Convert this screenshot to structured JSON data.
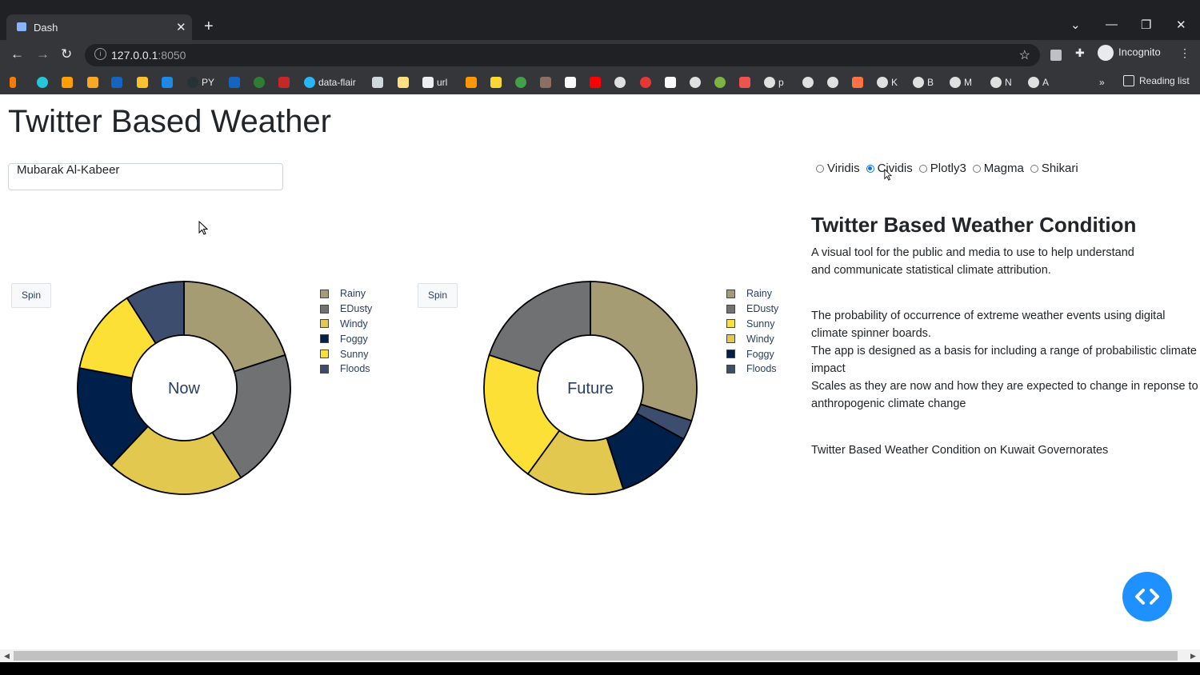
{
  "browser": {
    "tab_title": "Dash",
    "url_host": "127.0.0.1",
    "url_port": ":8050",
    "profile": "Incognito",
    "bookmarks": [
      "PY",
      "data-flair",
      "url",
      "p",
      "K",
      "B",
      "M",
      "N",
      "A"
    ],
    "reading_list": "Reading list"
  },
  "page": {
    "title": "Twitter Based Weather",
    "governorate_input": "Mubarak Al-Kabeer",
    "colorscales": [
      {
        "label": "Viridis",
        "selected": false
      },
      {
        "label": "Cividis",
        "selected": true
      },
      {
        "label": "Plotly3",
        "selected": false
      },
      {
        "label": "Magma",
        "selected": false
      },
      {
        "label": "Shikari",
        "selected": false
      }
    ],
    "spin_label": "Spin",
    "panel": {
      "heading": "Twitter Based Weather Condition",
      "intro_line1": "A visual tool for the public and media to use to help understand",
      "intro_line2": "and communicate statistical climate attribution.",
      "p1_line1": "The probability of occurrence of extreme weather events using digital",
      "p1_line2": "climate spinner boards.",
      "p2_line1": "The app is designed as a basis for including a range of probabilistic climate",
      "p2_line2": "impact",
      "p3_line1": "Scales as they are now and how they are expected to change in reponse to",
      "p3_line2": "anthropogenic climate change",
      "footer": "Twitter Based Weather Condition on Kuwait Governorates"
    }
  },
  "chart_data": [
    {
      "type": "pie",
      "hole_label": "Now",
      "categories": [
        "Rainy",
        "EDusty",
        "Windy",
        "Foggy",
        "Sunny",
        "Floods"
      ],
      "values": [
        0.2,
        0.21,
        0.21,
        0.16,
        0.13,
        0.09
      ],
      "legend_order": [
        "Rainy",
        "EDusty",
        "Windy",
        "Foggy",
        "Sunny",
        "Floods"
      ],
      "legend_placement": "right"
    },
    {
      "type": "pie",
      "hole_label": "Future",
      "categories": [
        "Rainy",
        "Floods",
        "Foggy",
        "Windy",
        "Sunny",
        "EDusty"
      ],
      "values": [
        0.3,
        0.03,
        0.12,
        0.15,
        0.2,
        0.2
      ],
      "legend_order": [
        "Rainy",
        "EDusty",
        "Sunny",
        "Windy",
        "Foggy",
        "Floods"
      ],
      "legend_placement": "right"
    }
  ],
  "colors": {
    "Rainy": "#a59c74",
    "EDusty": "#707173",
    "Windy": "#e2c84f",
    "Foggy": "#00204c",
    "Sunny": "#fde035",
    "Floods": "#3c4d6e",
    "accent": "#1e90ff"
  }
}
